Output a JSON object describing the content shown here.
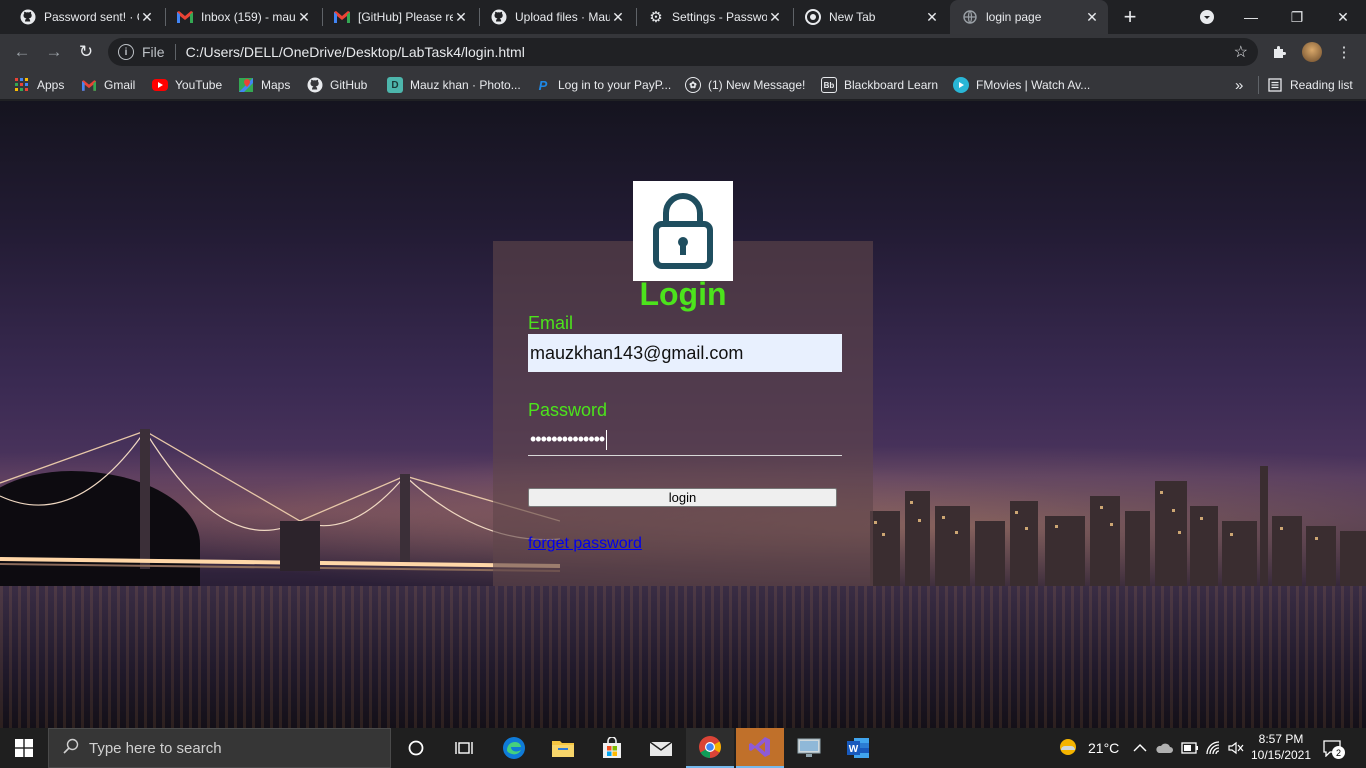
{
  "browser": {
    "tabs": [
      {
        "title": "Password sent! · G",
        "icon": "github-icon"
      },
      {
        "title": "Inbox (159) - mau",
        "icon": "gmail-icon"
      },
      {
        "title": "[GitHub] Please re",
        "icon": "gmail-icon"
      },
      {
        "title": "Upload files · Mau",
        "icon": "github-icon"
      },
      {
        "title": "Settings - Passwo",
        "icon": "gear-icon"
      },
      {
        "title": "New Tab",
        "icon": "chrome-icon"
      },
      {
        "title": "login page",
        "icon": "globe-icon",
        "active": true
      }
    ],
    "address": {
      "scheme_label": "File",
      "url": "C:/Users/DELL/OneDrive/Desktop/LabTask4/login.html"
    },
    "bookmarks": [
      {
        "label": "Apps",
        "icon": "apps-grid-icon"
      },
      {
        "label": "Gmail",
        "icon": "gmail-icon"
      },
      {
        "label": "YouTube",
        "icon": "youtube-icon"
      },
      {
        "label": "Maps",
        "icon": "maps-icon"
      },
      {
        "label": "GitHub",
        "icon": "github-icon"
      },
      {
        "label": "Mauz khan · Photo...",
        "icon": "photo-icon"
      },
      {
        "label": "Log in to your PayP...",
        "icon": "paypal-icon"
      },
      {
        "label": "(1) New Message!",
        "icon": "message-icon"
      },
      {
        "label": "Blackboard Learn",
        "icon": "blackboard-icon"
      },
      {
        "label": "FMovies | Watch Av...",
        "icon": "play-icon"
      }
    ],
    "bookmarks_overflow": "»",
    "reading_list": "Reading list"
  },
  "login": {
    "heading": "Login",
    "email_label": "Email",
    "email_value": "mauzkhan143@gmail.com",
    "password_label": "Password",
    "password_mask": "••••••••••••••",
    "submit_label": "login",
    "forgot_link": "forget password"
  },
  "taskbar": {
    "search_placeholder": "Type here to search",
    "weather": "21°C",
    "time": "8:57 PM",
    "date": "10/15/2021",
    "notifications": "2"
  },
  "colors": {
    "accent_green": "#4ce31c",
    "link_blue": "#0000ee",
    "autofill_bg": "#e8f0fe"
  }
}
